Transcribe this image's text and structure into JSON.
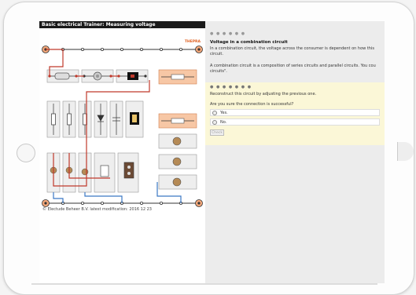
{
  "app": {
    "title": "Basic electrical Trainer: Measuring voltage",
    "logo": "THEPRA"
  },
  "footer": "© Electude Beheer B.V.   latest modification: 2016 12 23",
  "lesson": {
    "progress": "● ● ● ● ● ●",
    "heading": "Voltage in a combination circuit",
    "paragraph1": "In a combination circuit, the voltage across the consumer is dependent on how this circuit.",
    "paragraph2": "A combination circuit is a composition of series circuits and parallel circuits. You cou circuits\"."
  },
  "question": {
    "progress": "● ● ● ● ● ● ●",
    "instruction": "Reconstruct this circuit by adjusting the previous one.",
    "prompt": "Are you sure the connection is successful?",
    "options": [
      "Yes.",
      "No."
    ],
    "check_label": "Check"
  },
  "colors": {
    "accent": "#f0a87a",
    "wire_red": "#c0392b",
    "wire_blue": "#3b78c4",
    "panel_yellow": "#fbf7d7"
  }
}
